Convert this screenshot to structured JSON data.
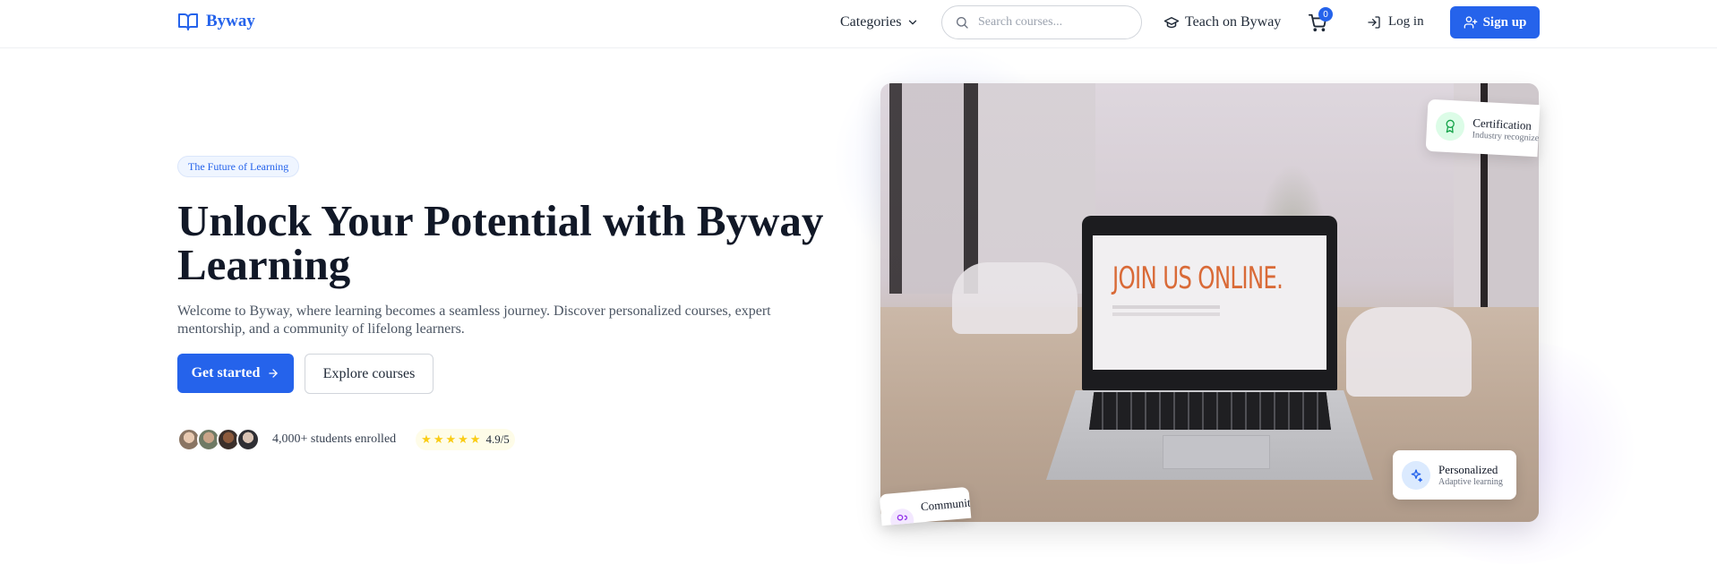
{
  "brand": {
    "name": "Byway",
    "icon": "open-book-icon",
    "color": "#2563eb"
  },
  "nav": {
    "categories_label": "Categories",
    "search_placeholder": "Search courses...",
    "teach_label": "Teach on Byway",
    "cart_count": "0",
    "login_label": "Log in",
    "signup_label": "Sign up"
  },
  "hero": {
    "pill": "The Future of Learning",
    "headline": "Unlock Your Potential with Byway Learning",
    "subtext": "Welcome to Byway, where learning becomes a seamless journey. Discover personalized courses, expert mentorship, and a community of lifelong learners.",
    "primary_cta": "Get started",
    "secondary_cta": "Explore courses",
    "students_text": "4,000+ students enrolled",
    "stars": [
      "★",
      "★",
      "★",
      "★",
      "★"
    ],
    "rating": "4.9/5",
    "image_text": "JOIN US ONLINE."
  },
  "cards": {
    "certification": {
      "title": "Certification",
      "subtitle": "Industry recognized",
      "icon": "award-icon",
      "color": "#16a34a"
    },
    "personalized": {
      "title": "Personalized",
      "subtitle": "Adaptive learning",
      "icon": "sparkles-icon",
      "color": "#2563eb"
    },
    "community": {
      "title": "Community",
      "icon": "users-icon",
      "color": "#9333ea"
    }
  }
}
